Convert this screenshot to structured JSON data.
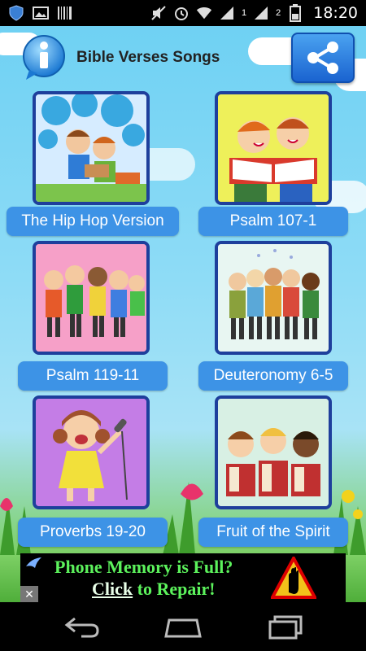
{
  "status_bar": {
    "time": "18:20",
    "sim1": "1",
    "sim2": "2"
  },
  "header": {
    "title": "Bible Verses Songs"
  },
  "songs": [
    {
      "label": "The Hip Hop Version"
    },
    {
      "label": "Psalm 107-1"
    },
    {
      "label": "Psalm 119-11"
    },
    {
      "label": "Deuteronomy 6-5"
    },
    {
      "label": "Proverbs 19-20"
    },
    {
      "label": "Fruit of the Spirit"
    }
  ],
  "ad": {
    "line1": "Phone Memory is Full?",
    "line2_link": "Click",
    "line2_rest": " to Repair!",
    "close": "✕"
  },
  "colors": {
    "label_bg": "#3d93e6",
    "thumb_border": "#1e3f9c",
    "ad_text": "#5cf25c"
  }
}
